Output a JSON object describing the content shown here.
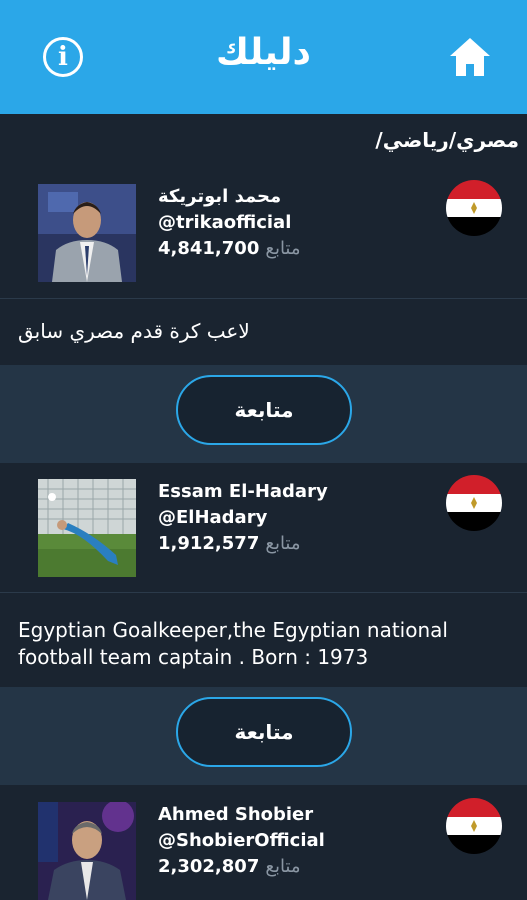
{
  "appbar": {
    "title": "دليلك",
    "info_icon": "info-icon",
    "home_icon": "home-icon",
    "color": "#2ba7e8"
  },
  "breadcrumb": "مصري/رياضي/",
  "follow_label": "متابعة",
  "followers_unit": "متابع",
  "profiles": [
    {
      "name": "محمد ابوتريكة",
      "handle": "@trikaofficial",
      "followers": "4,841,700",
      "description": "لاعب كرة قدم مصري سابق",
      "flag": "egypt-flag-icon"
    },
    {
      "name": "Essam El-Hadary",
      "handle": "@ElHadary",
      "followers": "1,912,577",
      "description": "Egyptian Goalkeeper,the Egyptian national football team captain . Born : 1973",
      "flag": "egypt-flag-icon"
    },
    {
      "name": "Ahmed Shobier",
      "handle": "@ShobierOfficial",
      "followers": "2,302,807",
      "flag": "egypt-flag-icon"
    }
  ]
}
